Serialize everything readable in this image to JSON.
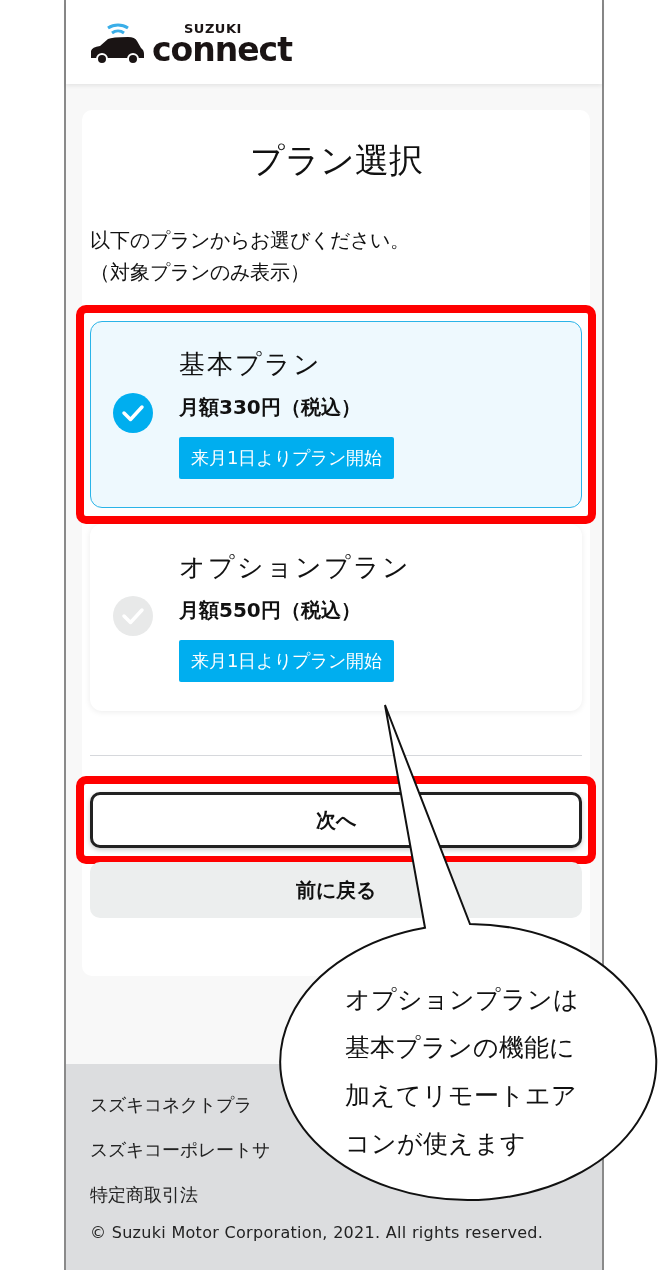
{
  "header": {
    "brand_top": "SUZUKI",
    "brand_main": "connect"
  },
  "page": {
    "title": "プラン選択",
    "instructions": [
      "以下のプランからお選びください。",
      "（対象プランのみ表示）"
    ]
  },
  "plans": [
    {
      "name": "基本プラン",
      "price": "月額330円（税込）",
      "tag": "来月1日よりプラン開始",
      "selected": true,
      "highlighted": true
    },
    {
      "name": "オプションプラン",
      "price": "月額550円（税込）",
      "tag": "来月1日よりプラン開始",
      "selected": false,
      "highlighted": false
    }
  ],
  "buttons": [
    {
      "label": "次へ",
      "kind": "primary",
      "highlighted": true
    },
    {
      "label": "前に戻る",
      "kind": "secondary",
      "highlighted": false
    }
  ],
  "footer": {
    "links": [
      "スズキコネクトプラ",
      "スズキコーポレートサ",
      "特定商取引法"
    ],
    "copyright": "© Suzuki Motor Corporation, 2021. All rights reserved."
  },
  "callout": {
    "lines": [
      "オプションプランは",
      "基本プランの機能に",
      "加えてリモートエア",
      "コンが使えます"
    ]
  }
}
